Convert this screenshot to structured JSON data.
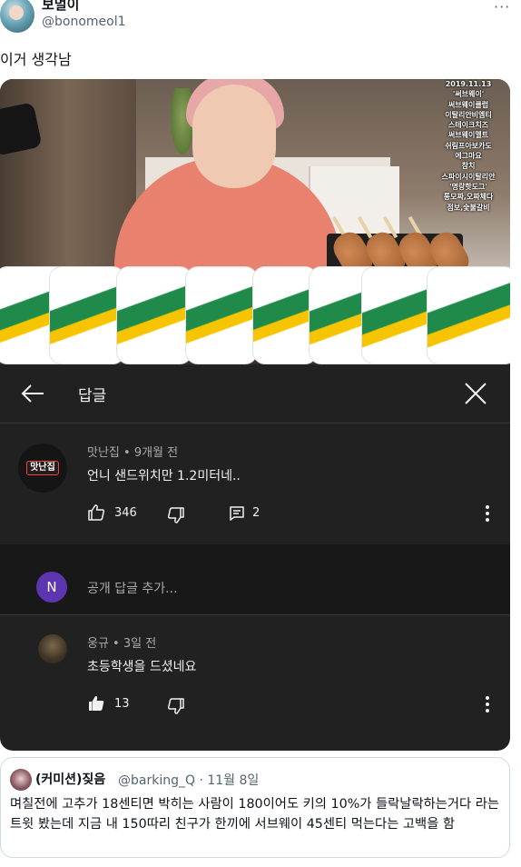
{
  "tweet": {
    "display_name": "보멀이",
    "handle": "@bonomeol1",
    "more": "···",
    "text": "이거 생각남"
  },
  "video": {
    "menu_lines": [
      "2019.11.13",
      "'써브웨이'",
      "써브웨이클럽",
      "이탈리안비엠티",
      "스테이크치즈",
      "써브웨이멜트",
      "쉬림프아보카도",
      "에그마요",
      "참치",
      "스파이시이탈리안",
      "'명랑핫도그'",
      "통모짜,오짜체다",
      "점보,숯불갈비"
    ]
  },
  "replies_panel": {
    "title": "답글",
    "back_icon": "arrow-left-icon",
    "close_icon": "close-icon",
    "top_comment": {
      "avatar_text": "맛난집",
      "meta": "맛난집 • 9개월 전",
      "text": "언니 샌드위치만 1.2미터네..",
      "likes": "346",
      "replies": "2"
    },
    "add_reply": {
      "avatar_letter": "N",
      "placeholder": "공개 답글 추가..."
    },
    "reply": {
      "meta": "웅규 • 3일 전",
      "text": "초등학생을 드셨네요",
      "likes": "13"
    },
    "colors": {
      "panel_bg": "#212121",
      "add_bg": "#181818",
      "text": "#f1f1f1",
      "meta": "#aaaaaa",
      "avatar_n": "#5e35b1"
    }
  },
  "quote": {
    "display_name": "(커미션)짖음",
    "handle_time": "@barking_Q · 11월 8일",
    "text": "며칠전에 고추가 18센티면 박히는 사람이 180이어도 키의 10%가 들락날락하는거다 라는 트윗 봤는데 지금 내 150따리 친구가 한끼에 서브웨이 45센티 먹는다는 고백을 함"
  }
}
